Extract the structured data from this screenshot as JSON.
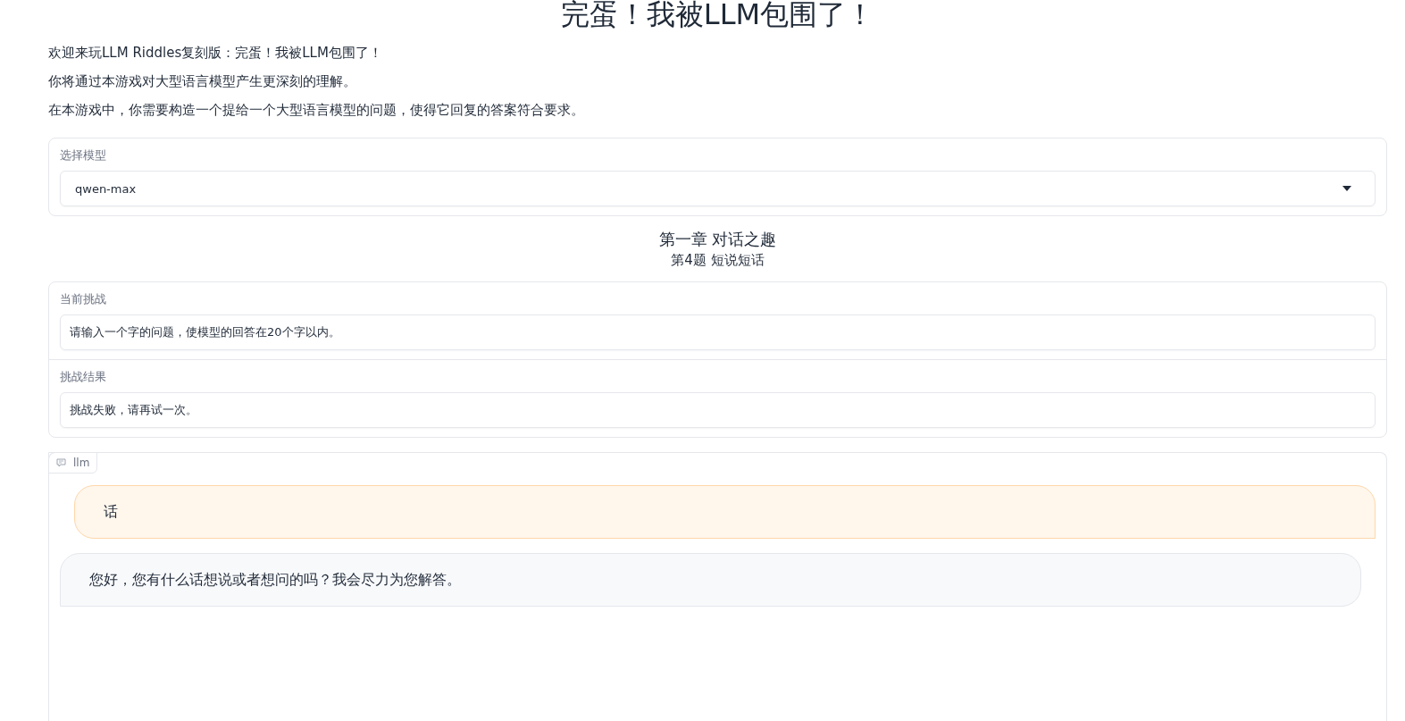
{
  "title": "完蛋！我被LLM包围了！",
  "intro": [
    "欢迎来玩LLM Riddles复刻版：完蛋！我被LLM包围了！",
    "你将通过本游戏对大型语言模型产生更深刻的理解。",
    "在本游戏中，你需要构造一个提给一个大型语言模型的问题，使得它回复的答案符合要求。"
  ],
  "model_select": {
    "label": "选择模型",
    "value": "qwen-max"
  },
  "chapter": {
    "title": "第一章 对话之趣",
    "subtitle": "第4题 短说短话"
  },
  "challenge": {
    "label": "当前挑战",
    "value": "请输入一个字的问题，使模型的回答在20个字以内。"
  },
  "result": {
    "label": "挑战结果",
    "value": "挑战失败，请再试一次。"
  },
  "chatbot": {
    "label": "llm",
    "messages": [
      {
        "kind": "user",
        "text": "话"
      },
      {
        "kind": "bot",
        "text": "您好，您有什么话想说或者想问的吗？我会尽力为您解答。"
      }
    ]
  }
}
